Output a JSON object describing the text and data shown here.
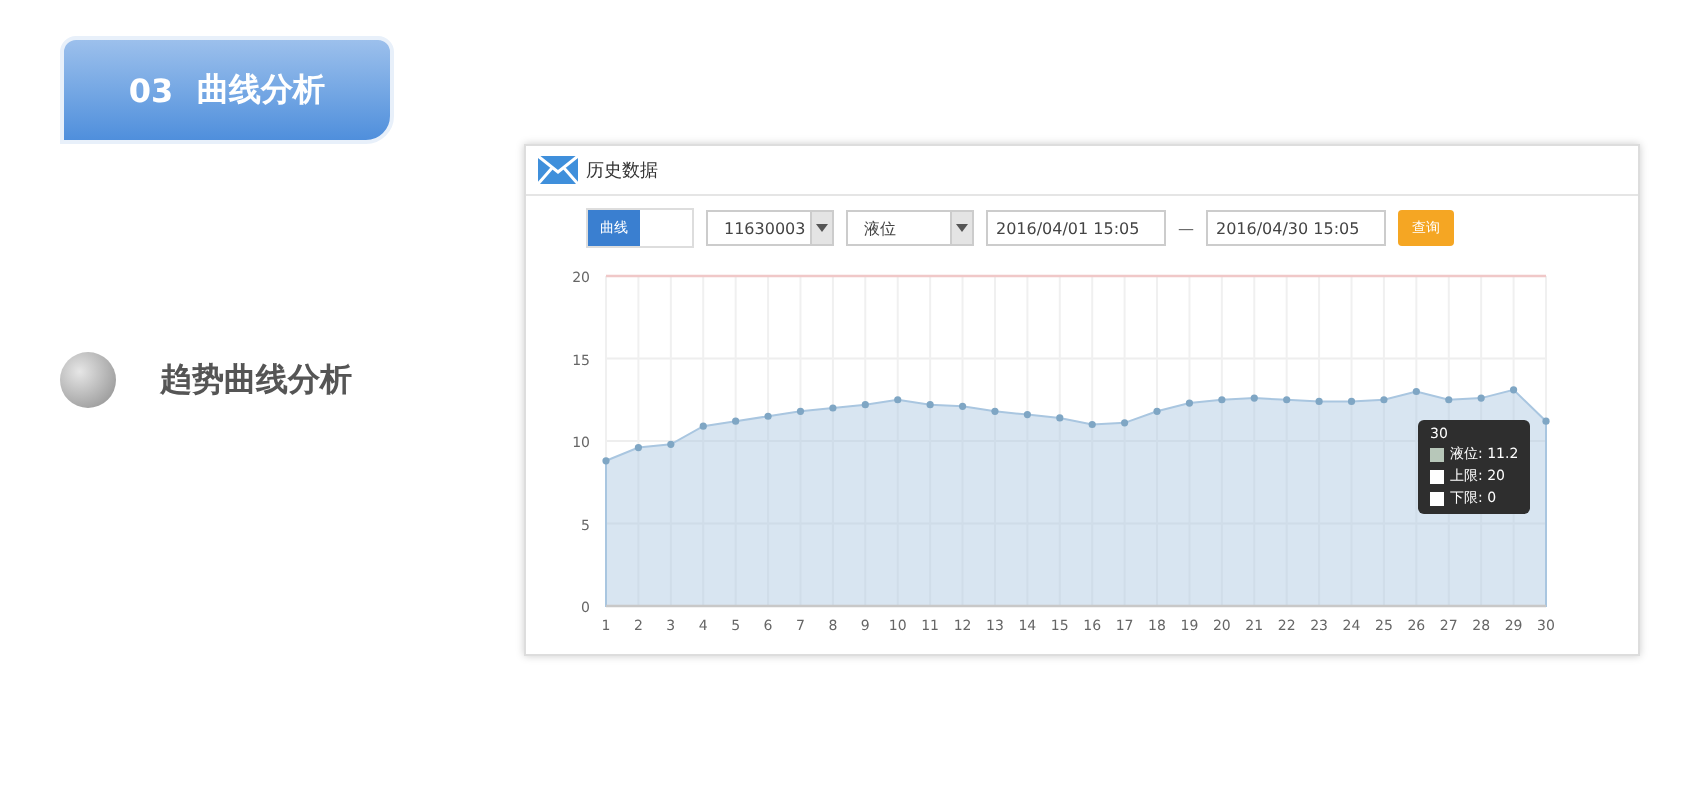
{
  "header_badge": {
    "number": "03",
    "title": "曲线分析"
  },
  "section": {
    "title": "趋势曲线分析"
  },
  "panel": {
    "title": "历史数据",
    "view_modes": [
      {
        "label": "曲线",
        "selected": true
      }
    ],
    "device_select": {
      "value": "11630003"
    },
    "metric_select": {
      "value": "液位"
    },
    "date_from": {
      "value": "2016/04/01 15:05"
    },
    "date_separator": "—",
    "date_to": {
      "value": "2016/04/30 15:05"
    },
    "query_button": "查询",
    "chart_data": {
      "type": "area",
      "grid": true,
      "x": [
        1,
        2,
        3,
        4,
        5,
        6,
        7,
        8,
        9,
        10,
        11,
        12,
        13,
        14,
        15,
        16,
        17,
        18,
        19,
        20,
        21,
        22,
        23,
        24,
        25,
        26,
        27,
        28,
        29,
        30
      ],
      "xlim": [
        1,
        30
      ],
      "ylim": [
        0,
        20
      ],
      "yticks": [
        0,
        5,
        10,
        15,
        20
      ],
      "xticks": [
        1,
        2,
        3,
        4,
        5,
        6,
        7,
        8,
        9,
        10,
        11,
        12,
        13,
        14,
        15,
        16,
        17,
        18,
        19,
        20,
        21,
        22,
        23,
        24,
        25,
        26,
        27,
        28,
        29,
        30
      ],
      "series": [
        {
          "name": "液位",
          "color": "#a9c6e0",
          "values": [
            8.8,
            9.6,
            9.8,
            10.9,
            11.2,
            11.5,
            11.8,
            12.0,
            12.2,
            12.5,
            12.2,
            12.1,
            11.8,
            11.6,
            11.4,
            11.0,
            11.1,
            11.8,
            12.3,
            12.5,
            12.6,
            12.5,
            12.4,
            12.4,
            12.5,
            13.0,
            12.5,
            12.6,
            13.1,
            11.2
          ]
        },
        {
          "name": "上限",
          "type": "line",
          "color": "#f0c8c8",
          "values": [
            20,
            20,
            20,
            20,
            20,
            20,
            20,
            20,
            20,
            20,
            20,
            20,
            20,
            20,
            20,
            20,
            20,
            20,
            20,
            20,
            20,
            20,
            20,
            20,
            20,
            20,
            20,
            20,
            20,
            20
          ]
        },
        {
          "name": "下限",
          "type": "line",
          "color": "#c8c8c8",
          "values": [
            0,
            0,
            0,
            0,
            0,
            0,
            0,
            0,
            0,
            0,
            0,
            0,
            0,
            0,
            0,
            0,
            0,
            0,
            0,
            0,
            0,
            0,
            0,
            0,
            0,
            0,
            0,
            0,
            0,
            0
          ]
        }
      ]
    },
    "tooltip": {
      "title": "30",
      "separator": ":",
      "items": [
        {
          "value": "11.2",
          "color": "#b7c7b9"
        },
        {
          "value": "20",
          "color": "#ffffff"
        },
        {
          "value": "0",
          "color": "#ffffff"
        }
      ]
    }
  }
}
